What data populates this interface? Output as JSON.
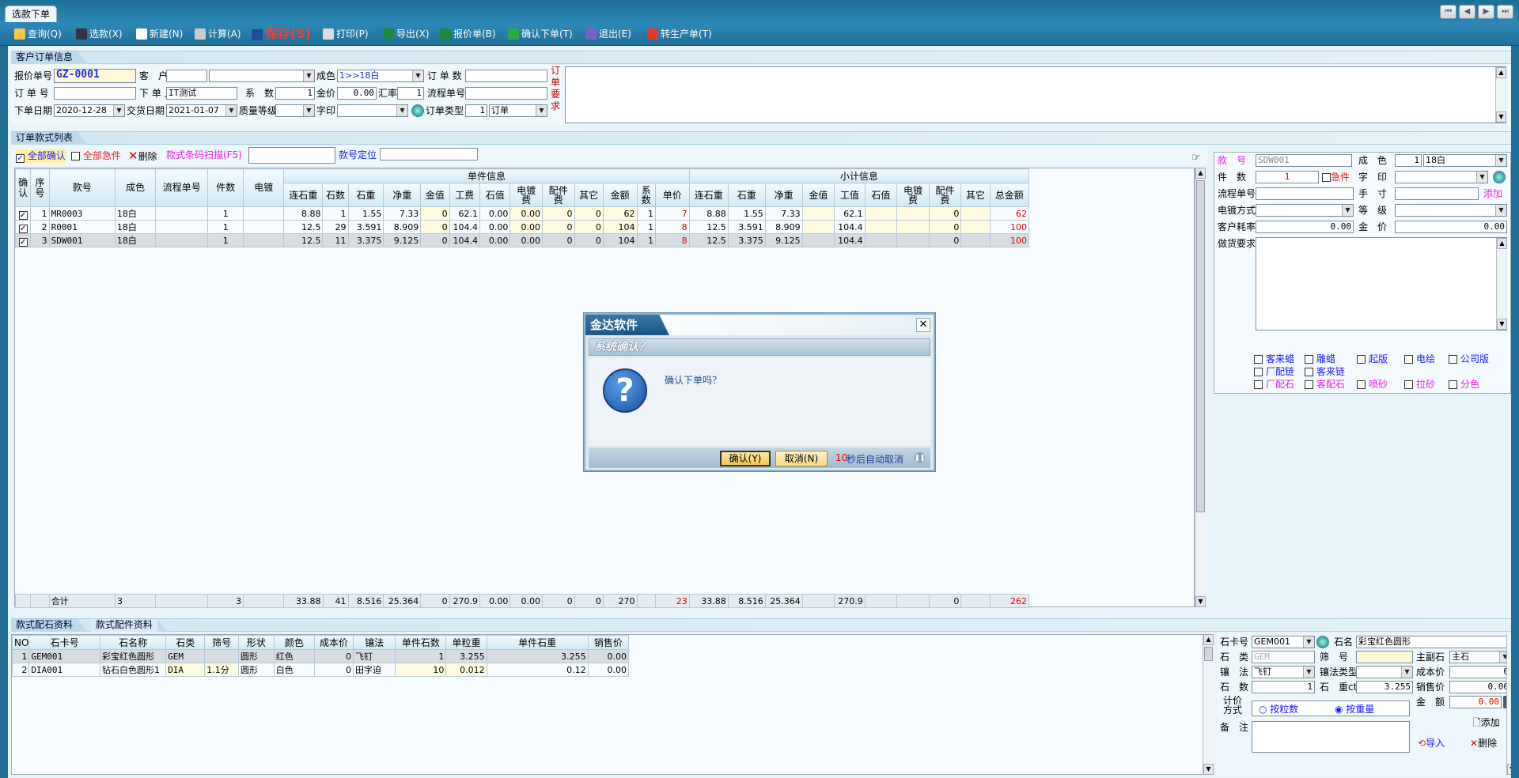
{
  "window": {
    "tab": "选款下单",
    "nav": [
      "⏮",
      "◀",
      "▶",
      "⏭"
    ]
  },
  "toolbar": [
    {
      "label": "查询(Q)",
      "icon": "search-icon",
      "color": "#f7c948"
    },
    {
      "label": "选款(X)",
      "icon": "binoculars-icon",
      "color": "#334"
    },
    {
      "label": "新建(N)",
      "icon": "new-doc-icon",
      "color": "#fff"
    },
    {
      "label": "计算(A)",
      "icon": "calculator-icon",
      "color": "#ccc"
    },
    {
      "label": "保存(S)",
      "icon": "save-icon",
      "color": "#1b4c9e"
    },
    {
      "label": "打印(P)",
      "icon": "printer-icon",
      "color": "#ddd"
    },
    {
      "label": "导出(X)",
      "icon": "excel-icon",
      "color": "#1e8a3c"
    },
    {
      "label": "报价单(B)",
      "icon": "excel-icon",
      "color": "#1e8a3c"
    },
    {
      "label": "确认下单(T)",
      "icon": "check-icon",
      "color": "#2aa845"
    },
    {
      "label": "退出(E)",
      "icon": "exit-icon",
      "color": "#7a5ec8"
    },
    {
      "label": "转生产单(T)",
      "icon": "arrow-right-icon",
      "color": "#e23a2c"
    }
  ],
  "order_info": {
    "section": "客户订单信息",
    "quote_no_label": "报价单号",
    "quote_no": "GZ-0001",
    "customer_label": "客　户",
    "color_label": "成色",
    "color_value": "1>>18白",
    "order_count_label": "订 单 数",
    "order_no_label": "订 单 号",
    "ordered_by_label": "下 单 人",
    "ordered_by": "IT测试",
    "factor_label": "系　数",
    "factor": "1",
    "gold_price_label": "金价",
    "gold_price": "0.00",
    "rate_label": "汇率",
    "rate": "1",
    "flow_no_label": "流程单号",
    "order_date_label": "下单日期",
    "order_date": "2020-12-28",
    "delivery_label": "交货日期",
    "delivery_date": "2021-01-07",
    "quality_label": "质量等级",
    "mark_label": "字印",
    "order_type_label": "订单类型",
    "order_type_code": "1",
    "order_type": "订单",
    "req_label": "订单要求"
  },
  "list": {
    "section": "订单款式列表",
    "confirm_all": "全部确认",
    "urgent_all": "全部急件",
    "delete": "删除",
    "scan_label": "款式条码扫描(F5)",
    "locate_label": "款号定位",
    "group_single": "单件信息",
    "group_subtotal": "小计信息",
    "headers": [
      "确认",
      "序号",
      "款号",
      "成色",
      "流程单号",
      "件数",
      "电镀",
      "连石重",
      "石数",
      "石重",
      "净重",
      "金值",
      "工费",
      "石值",
      "电镀费",
      "配件费",
      "其它",
      "金额",
      "系数",
      "单价",
      "连石重",
      "石重",
      "净重",
      "金值",
      "工值",
      "石值",
      "电镀费",
      "配件费",
      "其它",
      "总金额"
    ],
    "rows": [
      [
        "✓",
        "1",
        "MR0003",
        "18白",
        "",
        "1",
        "",
        "8.88",
        "1",
        "1.55",
        "7.33",
        "0",
        "62.1",
        "0.00",
        "0.00",
        "0",
        "0",
        "62",
        "1",
        "7",
        "8.88",
        "1.55",
        "7.33",
        "",
        "62.1",
        "",
        "",
        "0",
        "",
        "62"
      ],
      [
        "✓",
        "2",
        "R0001",
        "18白",
        "",
        "1",
        "",
        "12.5",
        "29",
        "3.591",
        "8.909",
        "0",
        "104.4",
        "0.00",
        "0.00",
        "0",
        "0",
        "104",
        "1",
        "8",
        "12.5",
        "3.591",
        "8.909",
        "",
        "104.4",
        "",
        "",
        "0",
        "",
        "100"
      ],
      [
        "✓",
        "3",
        "SDW001",
        "18白",
        "",
        "1",
        "",
        "12.5",
        "11",
        "3.375",
        "9.125",
        "0",
        "104.4",
        "0.00",
        "0.00",
        "0",
        "0",
        "104",
        "1",
        "8",
        "12.5",
        "3.375",
        "9.125",
        "",
        "104.4",
        "",
        "",
        "0",
        "",
        "100"
      ]
    ],
    "total": [
      "",
      "",
      "合计",
      "3",
      "",
      "3",
      "",
      "33.88",
      "41",
      "8.516",
      "25.364",
      "0",
      "270.9",
      "0.00",
      "0.00",
      "0",
      "0",
      "270",
      "",
      "23",
      "33.88",
      "8.516",
      "25.364",
      "",
      "270.9",
      "",
      "",
      "0",
      "",
      "262"
    ]
  },
  "detail": {
    "style_no_label": "款　号",
    "style_no": "SDW001",
    "color_label": "成　色",
    "color_code": "1",
    "color": "18白",
    "qty_label": "件　数",
    "qty": "1",
    "urgent": "急件",
    "mark_label": "字　印",
    "flow_label": "流程单号",
    "size_label": "手　寸",
    "add": "添加",
    "plating_label": "电镀方式",
    "grade_label": "等　级",
    "loss_label": "客户耗率",
    "loss": "0.00",
    "gold_label": "金　价",
    "gold": "0.00",
    "req_label": "做货要求",
    "checks": [
      [
        "客来蜡",
        "#1a1aff"
      ],
      [
        "雕蜡",
        "#1a1aff"
      ],
      [
        "起版",
        "#1a1aff"
      ],
      [
        "电绘",
        "#1a1aff"
      ],
      [
        "公司版",
        "#1a1aff"
      ],
      [
        "厂配链",
        "#1a1aff"
      ],
      [
        "客来链",
        "#1a1aff"
      ],
      [
        "厂配石",
        "#e81ee8"
      ],
      [
        "客配石",
        "#e81ee8"
      ],
      [
        "喷砂",
        "#e81ee8"
      ],
      [
        "拉砂",
        "#e81ee8"
      ],
      [
        "分色",
        "#e81ee8"
      ]
    ]
  },
  "bottom": {
    "tabs": [
      "款式配石资料",
      "款式配件资料"
    ],
    "headers": [
      "NO",
      "石卡号",
      "石名称",
      "石类",
      "筛号",
      "形状",
      "颜色",
      "成本价",
      "镶法",
      "单件石数",
      "单粒重",
      "单件石重",
      "销售价"
    ],
    "rows": [
      [
        "1",
        "GEM001",
        "彩宝红色圆形",
        "GEM",
        "",
        "圆形",
        "红色",
        "0",
        "飞钉",
        "1",
        "3.255",
        "3.255",
        "0.00"
      ],
      [
        "2",
        "DIA001",
        "钻石白色圆形1",
        "DIA",
        "1.1分",
        "圆形",
        "白色",
        "0",
        "田字迫",
        "10",
        "0.012",
        "0.12",
        "0.00"
      ]
    ]
  },
  "stone": {
    "card_label": "石卡号",
    "card": "GEM001",
    "name_label": "石名",
    "name": "彩宝红色圆形",
    "type_label": "石　类",
    "type": "GEM",
    "sieve_label": "筛　号",
    "main_label": "主副石",
    "main": "主石",
    "setting_label": "镶　法",
    "setting": "飞钉",
    "setting_type_label": "镶法类型",
    "cost_label": "成本价",
    "cost": "0",
    "count_label": "石　数",
    "count": "1",
    "weight_label": "石　重ct",
    "weight": "3.255",
    "sale_label": "销售价",
    "sale": "0.00",
    "amount_label": "金　额",
    "amount": "0.00",
    "calc_label": "计价方式",
    "by_count": "按粒数",
    "by_weight": "按重量",
    "note_label": "备　注",
    "add": "添加",
    "import": "导入",
    "delete": "删除"
  },
  "dialog": {
    "brand": "金达软件",
    "title": "系统确认？",
    "message": "确认下单吗？",
    "ok": "确认(Y)",
    "cancel": "取消(N)",
    "countdown_num": "10",
    "countdown_text": "秒后自动取消"
  }
}
